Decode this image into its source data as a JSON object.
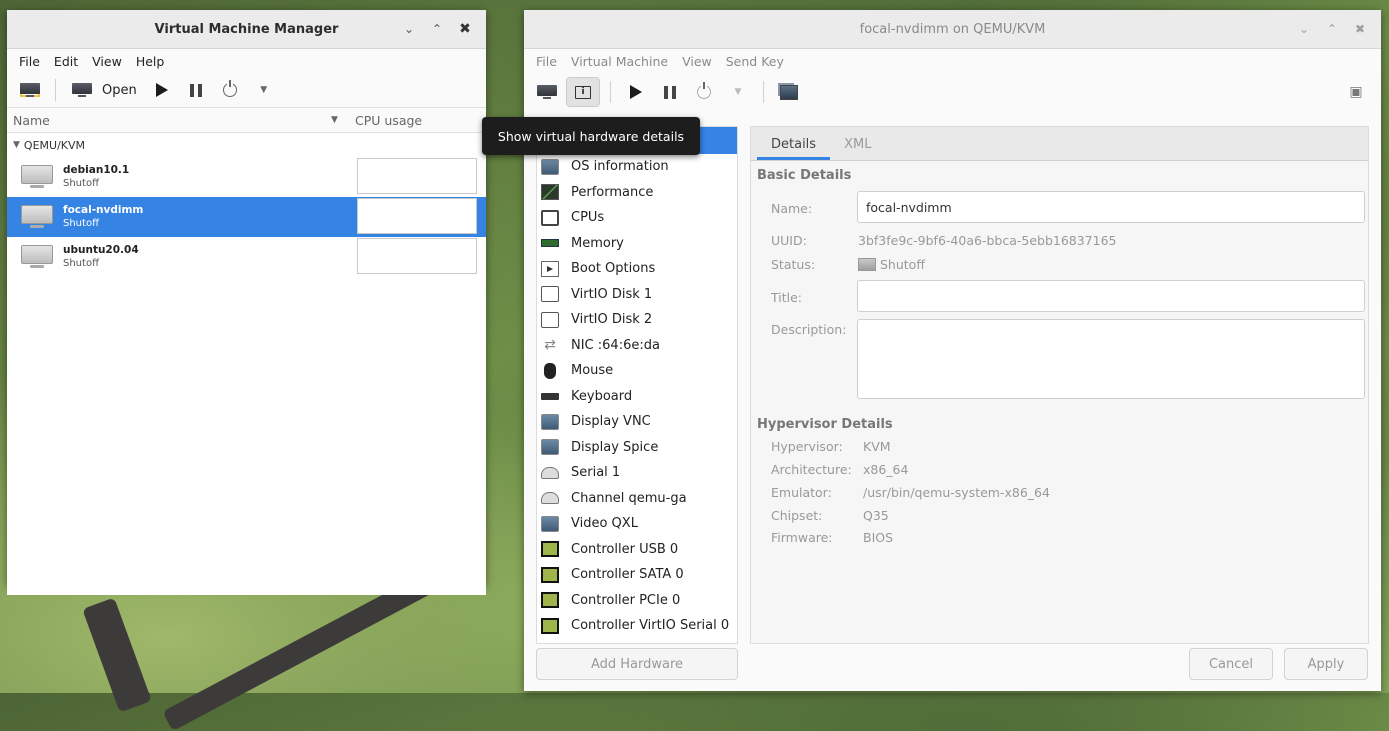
{
  "manager": {
    "title": "Virtual Machine Manager",
    "menu": [
      "File",
      "Edit",
      "View",
      "Help"
    ],
    "toolbar": {
      "open_label": "Open"
    },
    "columns": {
      "name": "Name",
      "cpu": "CPU usage"
    },
    "group": "QEMU/KVM",
    "vms": [
      {
        "name": "debian10.1",
        "state": "Shutoff"
      },
      {
        "name": "focal-nvdimm",
        "state": "Shutoff"
      },
      {
        "name": "ubuntu20.04",
        "state": "Shutoff"
      }
    ],
    "selected_vm": "focal-nvdimm"
  },
  "details": {
    "title": "focal-nvdimm on QEMU/KVM",
    "menu": [
      "File",
      "Virtual Machine",
      "View",
      "Send Key"
    ],
    "tooltip": "Show virtual hardware details",
    "hardware": [
      {
        "label": "OS information",
        "icon": "os-info-icon"
      },
      {
        "label": "Performance",
        "icon": "performance-icon"
      },
      {
        "label": "CPUs",
        "icon": "cpu-icon"
      },
      {
        "label": "Memory",
        "icon": "memory-icon"
      },
      {
        "label": "Boot Options",
        "icon": "boot-icon"
      },
      {
        "label": "VirtIO Disk 1",
        "icon": "disk-icon"
      },
      {
        "label": "VirtIO Disk 2",
        "icon": "disk-icon"
      },
      {
        "label": "NIC :64:6e:da",
        "icon": "network-icon"
      },
      {
        "label": "Mouse",
        "icon": "mouse-icon"
      },
      {
        "label": "Keyboard",
        "icon": "keyboard-icon"
      },
      {
        "label": "Display VNC",
        "icon": "display-icon"
      },
      {
        "label": "Display Spice",
        "icon": "display-icon"
      },
      {
        "label": "Serial 1",
        "icon": "serial-icon"
      },
      {
        "label": "Channel qemu-ga",
        "icon": "channel-icon"
      },
      {
        "label": "Video QXL",
        "icon": "video-icon"
      },
      {
        "label": "Controller USB 0",
        "icon": "controller-icon"
      },
      {
        "label": "Controller SATA 0",
        "icon": "controller-icon"
      },
      {
        "label": "Controller PCIe 0",
        "icon": "controller-icon"
      },
      {
        "label": "Controller VirtIO Serial 0",
        "icon": "controller-icon"
      }
    ],
    "tabs": {
      "details": "Details",
      "xml": "XML"
    },
    "basic": {
      "heading": "Basic Details",
      "name_label": "Name:",
      "name_value": "focal-nvdimm",
      "uuid_label": "UUID:",
      "uuid_value": "3bf3fe9c-9bf6-40a6-bbca-5ebb16837165",
      "status_label": "Status:",
      "status_value": "Shutoff",
      "title_label": "Title:",
      "title_value": "",
      "description_label": "Description:",
      "description_value": ""
    },
    "hypervisor": {
      "heading": "Hypervisor Details",
      "hypervisor_label": "Hypervisor:",
      "hypervisor_value": "KVM",
      "arch_label": "Architecture:",
      "arch_value": "x86_64",
      "emulator_label": "Emulator:",
      "emulator_value": "/usr/bin/qemu-system-x86_64",
      "chipset_label": "Chipset:",
      "chipset_value": "Q35",
      "firmware_label": "Firmware:",
      "firmware_value": "BIOS"
    },
    "buttons": {
      "add_hardware": "Add Hardware",
      "cancel": "Cancel",
      "apply": "Apply"
    }
  },
  "colors": {
    "accent": "#3584e4",
    "tooltip_bg": "#1d1d1d"
  }
}
